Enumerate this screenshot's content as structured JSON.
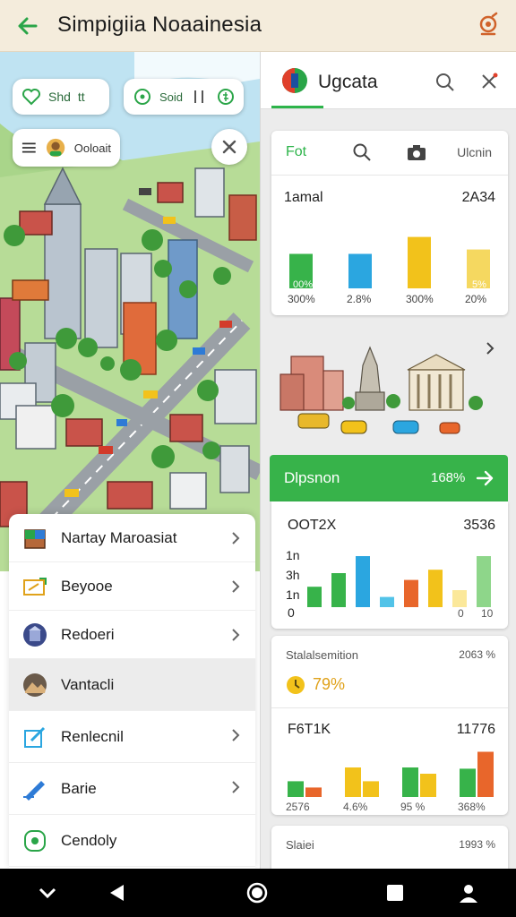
{
  "appbar": {
    "title": "Simpigiia Noaainesia",
    "back_icon": "arrow-left-icon",
    "action_icon": "location-pin-icon"
  },
  "map": {
    "chip1": {
      "label_a": "Shd",
      "label_b": "tt"
    },
    "chip2": {
      "label": "Soid"
    },
    "chip3": {
      "label": "Ooloait"
    }
  },
  "list": {
    "items": [
      {
        "label": "Nartay Maroasiat",
        "icon": "crate-icon"
      },
      {
        "label": "Beyooe",
        "icon": "ticket-icon"
      },
      {
        "label": "Redoeri",
        "icon": "building-badge-icon"
      },
      {
        "label": "Vantacli",
        "icon": "landscape-badge-icon"
      },
      {
        "label": "Renlecnil",
        "icon": "pencil-icon"
      },
      {
        "label": "Barie",
        "icon": "pen-icon"
      },
      {
        "label": "Cendoly",
        "icon": "shield-icon"
      }
    ]
  },
  "right": {
    "header": {
      "name": "Ugcata"
    },
    "card1": {
      "tabs": {
        "first": "Fot",
        "last": "Ulcnin"
      },
      "title": "1amal",
      "value": "2A34",
      "bar_inner_labels": [
        "00%",
        "5%"
      ],
      "ticks": [
        "300%",
        "2.8%",
        "300%",
        "20%"
      ]
    },
    "green_banner": {
      "label": "Dlpsnon",
      "value": "168%"
    },
    "card2": {
      "title": "OOT2X",
      "value": "3536",
      "axis": [
        "1n",
        "3h",
        "1n",
        "0"
      ],
      "ticks": [
        "0",
        "10"
      ]
    },
    "card3": {
      "title": "Stalalsemition",
      "value": "2063 %",
      "stat": "79%",
      "sub_title": "F6T1K",
      "sub_value": "11776",
      "ticks": [
        "2576",
        "4.6%",
        "95 %",
        "368%"
      ]
    },
    "card4": {
      "title": "Slaiei",
      "value": "1993 %"
    }
  },
  "colors": {
    "accent": "#37b34a",
    "blue": "#2ba6e0",
    "yellow": "#f2c21b",
    "orange": "#e8662b"
  },
  "chart_data": [
    {
      "type": "bar",
      "title": "1amal",
      "categories": [
        "300%",
        "2.8%",
        "300%",
        "20%"
      ],
      "values": [
        0.55,
        0.55,
        0.82,
        0.62
      ],
      "ylim": [
        0,
        1
      ]
    },
    {
      "type": "bar",
      "title": "OOT2X",
      "series": [
        {
          "values": [
            0.3,
            0.5,
            0.75,
            0.15,
            0.4,
            0.55,
            0.25,
            0.75
          ]
        }
      ],
      "ylim": [
        0,
        1
      ]
    },
    {
      "type": "bar",
      "title": "F6T1K",
      "categories": [
        "2576",
        "4.6%",
        "95 %",
        "368%"
      ],
      "series": [
        {
          "values": [
            0.28,
            0.5,
            0.5,
            0.48
          ]
        },
        {
          "values": [
            0.18,
            0.28,
            0.4,
            0.75
          ]
        }
      ],
      "ylim": [
        0,
        1
      ]
    }
  ]
}
